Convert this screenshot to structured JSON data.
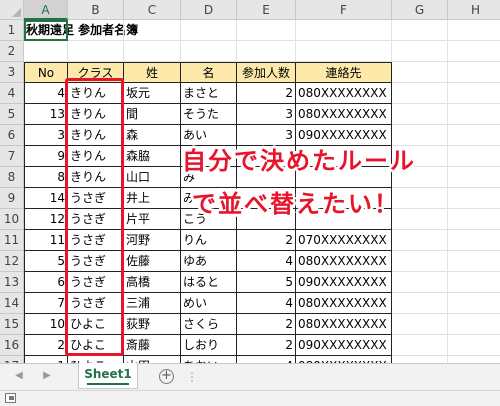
{
  "columns": [
    "A",
    "B",
    "C",
    "D",
    "E",
    "F",
    "G",
    "H"
  ],
  "row_numbers": [
    "1",
    "2",
    "3",
    "4",
    "5",
    "6",
    "7",
    "8",
    "9",
    "10",
    "11",
    "12",
    "13",
    "14",
    "15",
    "16",
    "17"
  ],
  "title": "秋期遠足 参加者名簿",
  "headers": [
    "No",
    "クラス",
    "姓",
    "名",
    "参加人数",
    "連絡先"
  ],
  "records": [
    [
      "4",
      "きりん",
      "坂元",
      "まさと",
      "2",
      "080XXXXXXXX"
    ],
    [
      "13",
      "きりん",
      "間",
      "そうた",
      "3",
      "080XXXXXXXX"
    ],
    [
      "3",
      "きりん",
      "森",
      "あい",
      "3",
      "090XXXXXXXX"
    ],
    [
      "9",
      "きりん",
      "森脇",
      "り",
      "",
      ""
    ],
    [
      "8",
      "きりん",
      "山口",
      "み",
      "",
      ""
    ],
    [
      "14",
      "うさぎ",
      "井上",
      "み",
      "",
      ""
    ],
    [
      "12",
      "うさぎ",
      "片平",
      "こう",
      "",
      ""
    ],
    [
      "11",
      "うさぎ",
      "河野",
      "りん",
      "2",
      "070XXXXXXXX"
    ],
    [
      "5",
      "うさぎ",
      "佐藤",
      "ゆあ",
      "4",
      "080XXXXXXXX"
    ],
    [
      "6",
      "うさぎ",
      "高橋",
      "はると",
      "5",
      "090XXXXXXXX"
    ],
    [
      "7",
      "うさぎ",
      "三浦",
      "めい",
      "4",
      "080XXXXXXXX"
    ],
    [
      "10",
      "ひよこ",
      "荻野",
      "さくら",
      "2",
      "080XXXXXXXX"
    ],
    [
      "2",
      "ひよこ",
      "斎藤",
      "しおり",
      "2",
      "090XXXXXXXX"
    ],
    [
      "1",
      "ひよこ",
      "山田",
      "あおい",
      "4",
      "080XXXXXXXX"
    ]
  ],
  "callout": {
    "line1": "自分で決めたルール",
    "line2": "で並べ替えたい！"
  },
  "sheet_tab": "Sheet1",
  "add_sheet_symbol": "+",
  "nav": {
    "prev": "◀",
    "next": "▶"
  },
  "scroll_dots": "⋮",
  "colors": {
    "accent_red": "#e8142b",
    "header_fill": "#fde9a9",
    "excel_green": "#217346"
  }
}
